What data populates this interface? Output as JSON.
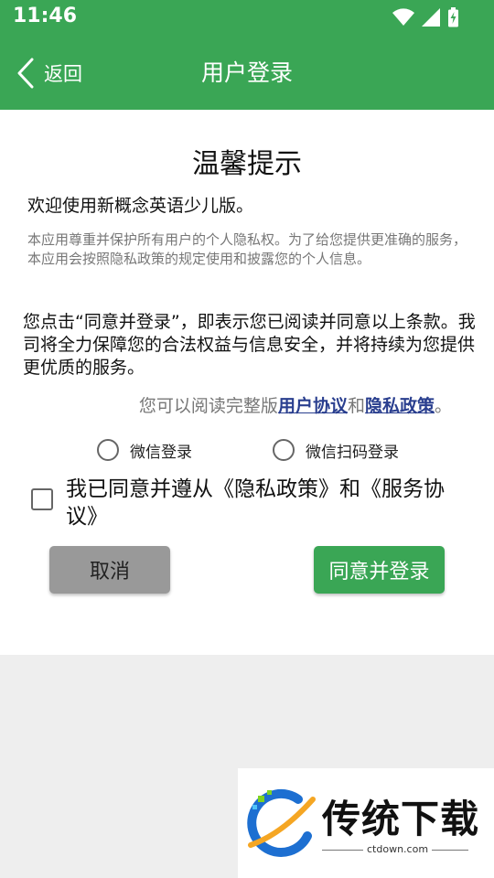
{
  "status_bar": {
    "time": "11:46"
  },
  "app_bar": {
    "back_label": "返回",
    "title": "用户登录"
  },
  "dialog": {
    "title": "温馨提示",
    "welcome": "欢迎使用新概念英语少儿版。",
    "intro": "本应用尊重并保护所有用户的个人隐私权。为了给您提供更准确的服务，本应用会按照隐私政策的规定使用和披露您的个人信息。",
    "notice": "您点击“同意并登录”，即表示您已阅读并同意以上条款。我司将全力保障您的合法权益与信息安全，并将持续为您提供更优质的服务。",
    "read_prefix": "您可以阅读完整版",
    "user_agreement_link": "用户协议",
    "read_and": "和",
    "privacy_link": "隐私政策",
    "read_suffix": "。",
    "login_options": [
      {
        "label": "微信登录",
        "selected": false
      },
      {
        "label": "微信扫码登录",
        "selected": false
      }
    ],
    "agree_checkbox": {
      "label": "我已同意并遵从《隐私政策》和《服务协议》",
      "checked": false
    },
    "cancel_button": "取消",
    "confirm_button": "同意并登录"
  },
  "watermark": {
    "brand": "传统下载",
    "site": "ctdown.com"
  },
  "colors": {
    "primary": "#3aa655",
    "link": "#2a3f8f",
    "cancel_bg": "#999999"
  }
}
